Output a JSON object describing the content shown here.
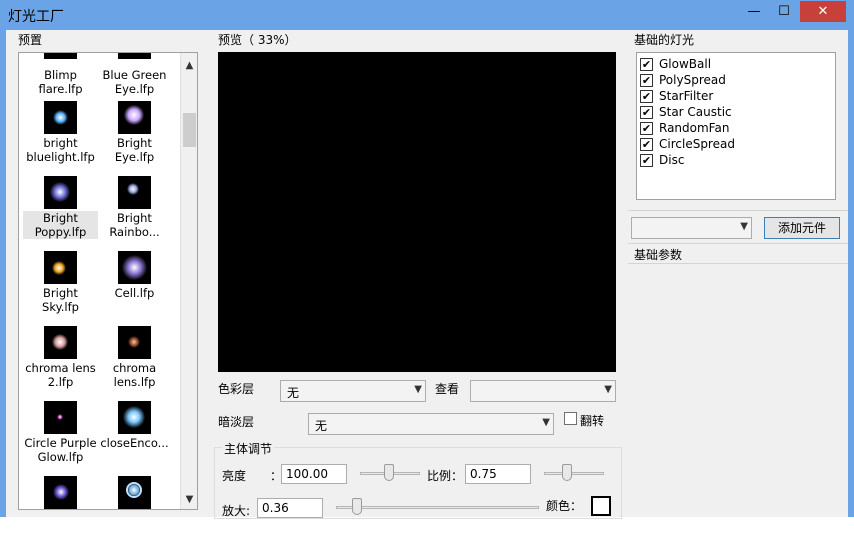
{
  "window": {
    "title": "灯光工厂",
    "minimize": "—",
    "maximize": "☐",
    "close": "✕"
  },
  "presets": {
    "label": "预置",
    "items": [
      {
        "label": "Blimp flare.lfp",
        "selected": false
      },
      {
        "label": "Blue Green Eye.lfp",
        "selected": false
      },
      {
        "label": "bright bluelight.lfp",
        "selected": false
      },
      {
        "label": "Bright Eye.lfp",
        "selected": false
      },
      {
        "label": "Bright Poppy.lfp",
        "selected": true
      },
      {
        "label": "Bright Rainbo...",
        "selected": false
      },
      {
        "label": "Bright Sky.lfp",
        "selected": false
      },
      {
        "label": "Cell.lfp",
        "selected": false
      },
      {
        "label": "chroma lens 2.lfp",
        "selected": false
      },
      {
        "label": "chroma lens.lfp",
        "selected": false
      },
      {
        "label": "Circle Purple Glow.lfp",
        "selected": false
      },
      {
        "label": "closeEnco...",
        "selected": false
      }
    ],
    "scroll_up": "▲",
    "scroll_down": "▼"
  },
  "preview": {
    "label": "预览（ 33%）"
  },
  "color_layer": {
    "label": "色彩层",
    "value": "无"
  },
  "view": {
    "label": "查看",
    "value": ""
  },
  "dim_layer": {
    "label": "暗淡层",
    "value": "无"
  },
  "flip": {
    "label": "翻转",
    "checked": false
  },
  "main_adjust": {
    "label": "主体调节",
    "brightness_label": "亮度",
    "brightness_colon": "：",
    "brightness_value": "100.00",
    "scale_label": "比例：",
    "scale_value": "0.75",
    "zoom_label": "放大:",
    "zoom_value": "0.36",
    "color_label": "颜色："
  },
  "basic_lights": {
    "label": "基础的灯光",
    "items": [
      {
        "label": "GlowBall",
        "checked": true
      },
      {
        "label": "PolySpread",
        "checked": true
      },
      {
        "label": "StarFilter",
        "checked": true
      },
      {
        "label": "Star Caustic",
        "checked": true
      },
      {
        "label": "RandomFan",
        "checked": true
      },
      {
        "label": "CircleSpread",
        "checked": true
      },
      {
        "label": "Disc",
        "checked": true
      }
    ]
  },
  "element_select": {
    "value": ""
  },
  "add_button": "添加元件",
  "basic_params": {
    "label": "基础参数"
  },
  "colors": {
    "titlebar": "#6aa3e6",
    "close": "#c7413a",
    "panel": "#f0f0f0"
  }
}
